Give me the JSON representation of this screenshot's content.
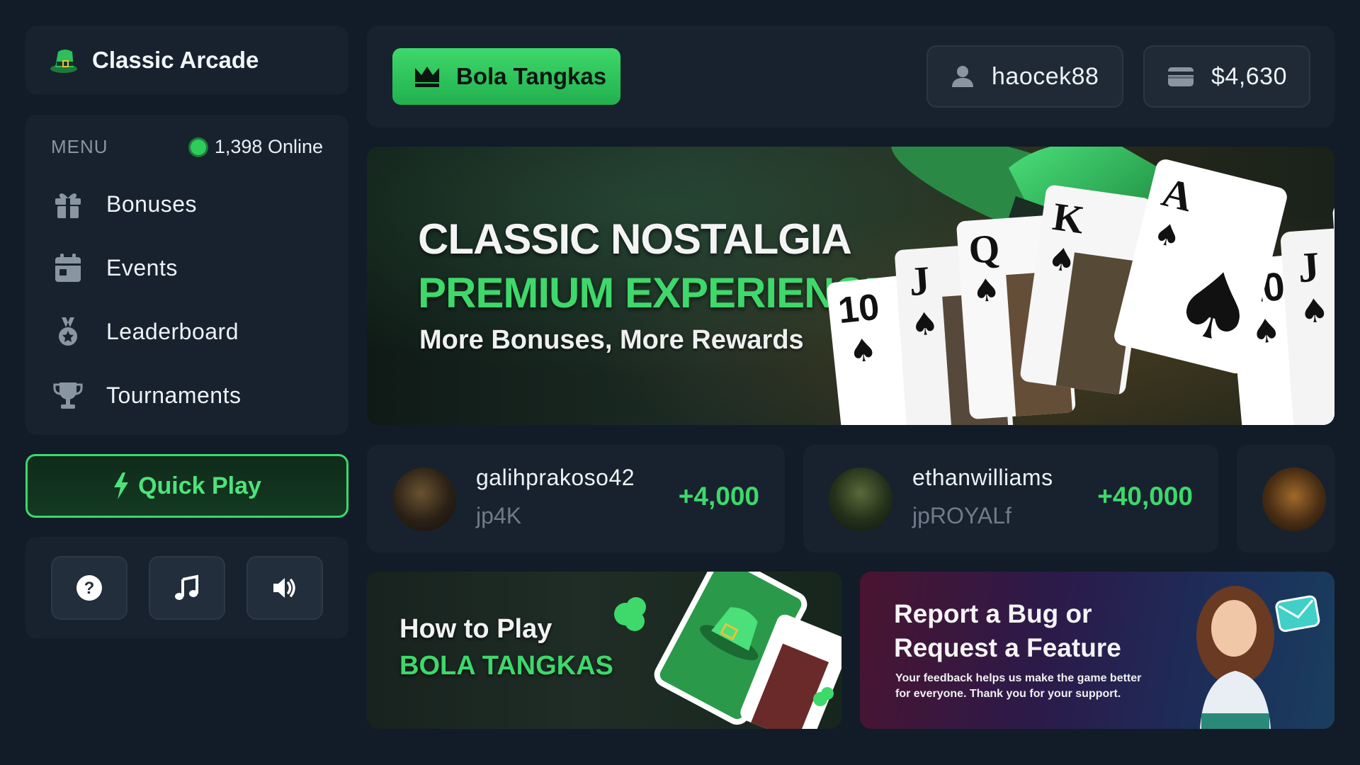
{
  "app": {
    "title": "Classic Arcade",
    "accent_color": "#3ed86b",
    "logo_icon": "leprechaun-hat-icon"
  },
  "sidebar": {
    "menu_label": "MENU",
    "online_text": "1,398 Online",
    "items": [
      {
        "label": "Bonuses",
        "icon": "gift-icon"
      },
      {
        "label": "Events",
        "icon": "calendar-icon"
      },
      {
        "label": "Leaderboard",
        "icon": "medal-icon"
      },
      {
        "label": "Tournaments",
        "icon": "trophy-icon"
      }
    ],
    "quick_play_label": "Quick Play",
    "controls": [
      {
        "icon": "help-icon"
      },
      {
        "icon": "music-icon"
      },
      {
        "icon": "volume-icon"
      }
    ]
  },
  "topbar": {
    "game_label": "Bola Tangkas",
    "username": "haocek88",
    "balance": "$4,630"
  },
  "hero": {
    "line1": "CLASSIC NOSTALGIA",
    "line2": "PREMIUM EXPERIENCE",
    "line3": "More Bonuses, More Rewards",
    "cards": [
      "10",
      "J",
      "Q",
      "K",
      "A"
    ]
  },
  "winners": [
    {
      "name": "galihprakoso42",
      "game": "jp4K",
      "amount": "+4,000"
    },
    {
      "name": "ethanwilliams",
      "game": "jpROYALf",
      "amount": "+40,000"
    },
    {
      "name": "",
      "game": "",
      "amount": ""
    }
  ],
  "promos": {
    "howto": {
      "line1": "How to Play",
      "line2": "BOLA TANGKAS"
    },
    "report": {
      "title": "Report a Bug or Request a Feature",
      "subtitle": "Your feedback helps us make the game better for everyone. Thank you for your support."
    }
  }
}
